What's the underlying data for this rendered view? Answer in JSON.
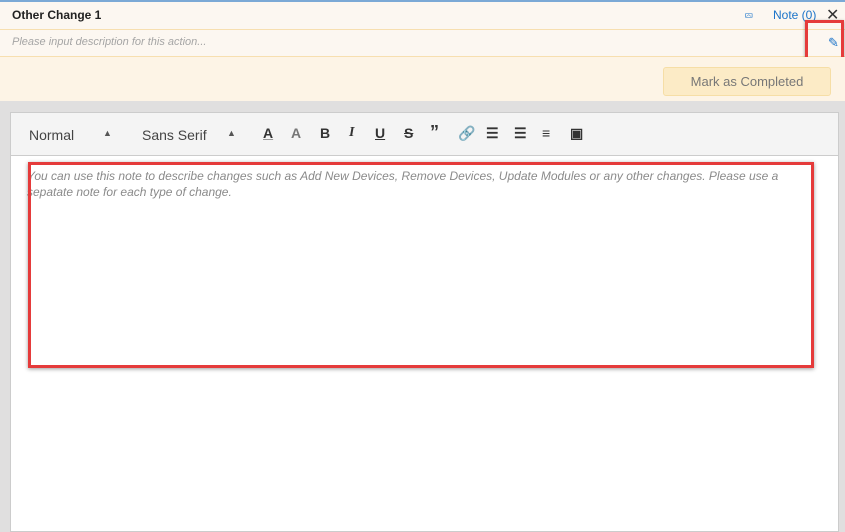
{
  "header": {
    "title": "Other Change 1",
    "note_label": "Note (0)",
    "close": "✕"
  },
  "description": {
    "placeholder": "Please input description for this action..."
  },
  "actions": {
    "mark_completed": "Mark as Completed"
  },
  "toolbar": {
    "heading": "Normal",
    "font": "Sans Serif"
  },
  "editor": {
    "placeholder": "You can use this note to describe changes such as Add New Devices, Remove Devices, Update Modules or any other changes. Please use a sepatate note for each type of change."
  }
}
